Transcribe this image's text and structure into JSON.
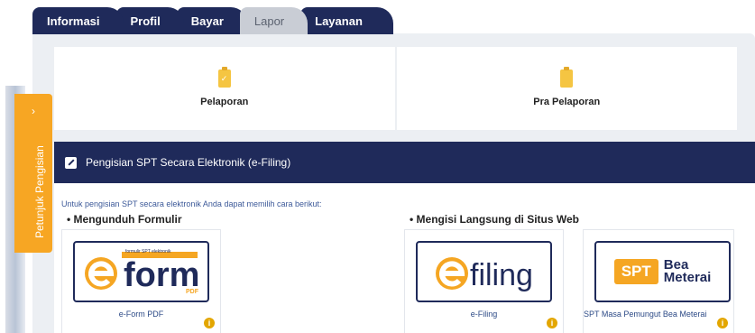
{
  "tabs": [
    {
      "label": "Informasi",
      "active": true
    },
    {
      "label": "Profil",
      "active": true
    },
    {
      "label": "Bayar",
      "active": true
    },
    {
      "label": "Lapor",
      "active": false
    },
    {
      "label": "Layanan",
      "active": true
    }
  ],
  "cards": [
    {
      "label": "Pelaporan",
      "icon": "clipboard-check-icon"
    },
    {
      "label": "Pra Pelaporan",
      "icon": "clipboard-icon"
    }
  ],
  "side_tab": {
    "label": "Petunjuk Pengisian",
    "chevron": "›"
  },
  "panel": {
    "title": "Pengisian SPT Secara Elektronik (e-Filing)",
    "intro": "Untuk pengisian SPT secara elektronik Anda dapat memilih cara berikut:",
    "section_download": "• Mengunduh Formulir",
    "section_web": "• Mengisi Langsung di Situs Web"
  },
  "tiles": [
    {
      "name": "e-Form PDF",
      "logo_text": "form",
      "logo_tag": "formulir SPT elektronik",
      "logo_sub": "PDF"
    },
    {
      "name": "e-Filing",
      "logo_text": "filing"
    },
    {
      "name": "SPT Masa Pemungut Bea Meterai",
      "logo_badge": "SPT",
      "logo_line1": "Bea",
      "logo_line2": "Meterai"
    }
  ],
  "colors": {
    "navy": "#1f2a5a",
    "orange": "#f7a623",
    "accent_blue": "#2c4a86"
  }
}
